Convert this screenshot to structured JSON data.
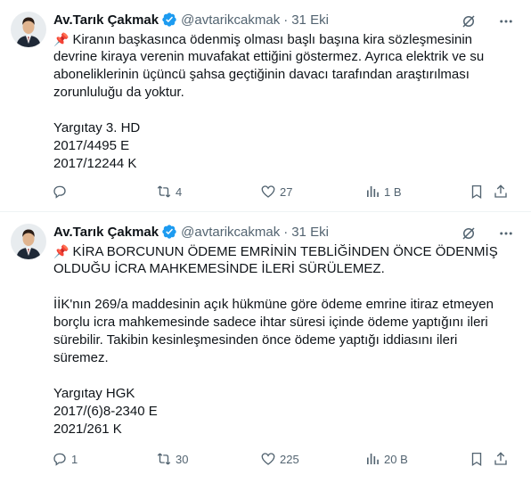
{
  "tweets": [
    {
      "author": "Av.Tarık Çakmak",
      "handle": "@avtarikcakmak",
      "separator": "·",
      "date": "31 Eki",
      "pin_icon": "pushpin",
      "lines": [
        "Kiranın başkasınca ödenmiş olması başlı başına kira sözleşmesinin",
        "devrine kiraya verenin muvafakat ettiğini göstermez. Ayrıca elektrik ve su",
        "aboneliklerinin üçüncü şahsa geçtiğinin davacı tarafından araştırılması",
        "zorunluluğu da yoktur.",
        "",
        "Yargıtay 3. HD",
        "2017/4495 E",
        "2017/12244 K"
      ],
      "replies": "",
      "reposts": "4",
      "likes": "27",
      "views": "1 B"
    },
    {
      "author": "Av.Tarık Çakmak",
      "handle": "@avtarikcakmak",
      "separator": "·",
      "date": "31 Eki",
      "pin_icon": "pushpin",
      "lines": [
        "KİRA BORCUNUN ÖDEME EMRİNİN TEBLİĞİNDEN ÖNCE ÖDENMİŞ",
        "OLDUĞU İCRA MAHKEMESİNDE İLERİ SÜRÜLEMEZ.",
        "",
        "İİK'nın 269/a maddesinin açık hükmüne göre ödeme emrine itiraz etmeyen",
        "borçlu icra mahkemesinde sadece ihtar süresi içinde ödeme yaptığını ileri",
        "sürebilir. Takibin kesinleşmesinden önce ödeme yaptığı iddiasını ileri",
        "süremez.",
        "",
        "Yargıtay HGK",
        "2017/(6)8-2340 E",
        "2021/261 K"
      ],
      "replies": "1",
      "reposts": "30",
      "likes": "225",
      "views": "20 B"
    }
  ],
  "colors": {
    "text": "#0f1419",
    "secondary": "#536471",
    "verified": "#1d9bf0",
    "pin": "#dd2e44",
    "divider": "#eff3f4"
  }
}
